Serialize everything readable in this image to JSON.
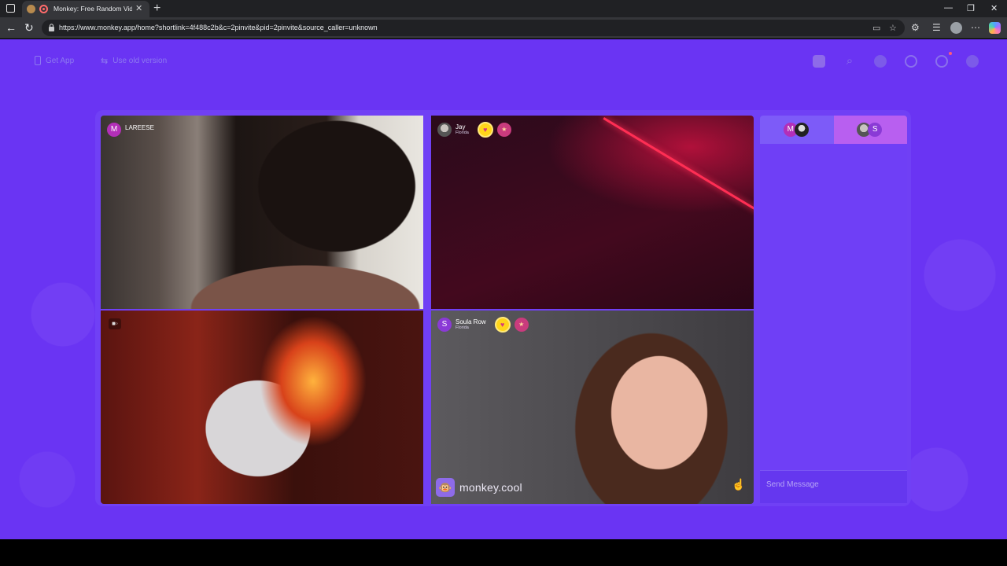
{
  "browser": {
    "tab_title": "Monkey: Free Random Video Chat",
    "tab_close": "✕",
    "new_tab": "+",
    "url": "https://www.monkey.app/home?shortlink=4f488c2b&c=2pinvite&pid=2pinvite&source_caller=unknown",
    "window_controls": {
      "minimize": "—",
      "maximize": "❐",
      "close": "✕"
    },
    "nav": {
      "back": "←",
      "reload": "↻"
    }
  },
  "page": {
    "get_app_label": "Get App",
    "old_version_label": "Use old version",
    "colors": {
      "background": "#6a34f3",
      "accent": "#ffd51a"
    }
  },
  "tiles": [
    {
      "avatar_letter": "M",
      "name": "LAREESE",
      "location": ""
    },
    {
      "avatar_letter": "",
      "name": "Jay",
      "location": "Florida"
    },
    {
      "avatar_letter": "",
      "name": "",
      "location": ""
    },
    {
      "avatar_letter": "S",
      "name": "Soula Row",
      "location": "Florida"
    }
  ],
  "brand": {
    "logo_glyph": "🐵",
    "text": "monkey.cool"
  },
  "chat": {
    "tab_a_letter": "M",
    "tab_b_letter": "S",
    "placeholder": "Send Message"
  }
}
